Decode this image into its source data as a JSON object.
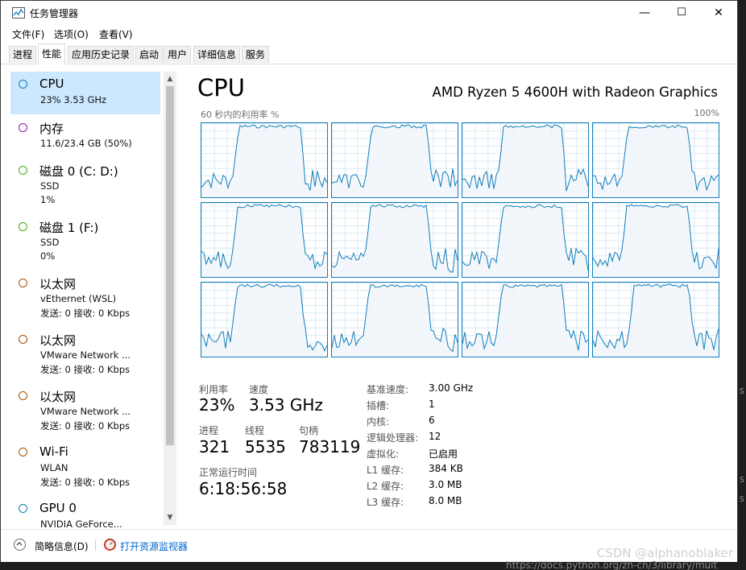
{
  "window": {
    "title": "任务管理器",
    "minimize": "—",
    "maximize": "☐",
    "close": "✕"
  },
  "menu": [
    "文件(F)",
    "选项(O)",
    "查看(V)"
  ],
  "tabs": [
    "进程",
    "性能",
    "应用历史记录",
    "启动",
    "用户",
    "详细信息",
    "服务"
  ],
  "active_tab": 1,
  "sidebar": {
    "items": [
      {
        "title": "CPU",
        "sub1": "23%  3.53 GHz",
        "sub2": "",
        "color": "#117dbb"
      },
      {
        "title": "内存",
        "sub1": "11.6/23.4 GB (50%)",
        "sub2": "",
        "color": "#8b12ae"
      },
      {
        "title": "磁盘 0 (C: D:)",
        "sub1": "SSD",
        "sub2": "1%",
        "color": "#4da60c"
      },
      {
        "title": "磁盘 1 (F:)",
        "sub1": "SSD",
        "sub2": "0%",
        "color": "#4da60c"
      },
      {
        "title": "以太网",
        "sub1": "vEthernet (WSL)",
        "sub2": "发送: 0 接收: 0 Kbps",
        "color": "#a74f01"
      },
      {
        "title": "以太网",
        "sub1": "VMware Network ...",
        "sub2": "发送: 0 接收: 0 Kbps",
        "color": "#a74f01"
      },
      {
        "title": "以太网",
        "sub1": "VMware Network ...",
        "sub2": "发送: 0 接收: 0 Kbps",
        "color": "#a74f01"
      },
      {
        "title": "Wi-Fi",
        "sub1": "WLAN",
        "sub2": "发送: 0 接收: 0 Kbps",
        "color": "#a74f01"
      },
      {
        "title": "GPU 0",
        "sub1": "NVIDIA GeForce...",
        "sub2": "",
        "color": "#117dbb"
      }
    ]
  },
  "cpu": {
    "title": "CPU",
    "model": "AMD Ryzen 5 4600H with Radeon Graphics",
    "graph_caption": "60 秒内的利用率 %",
    "graph_max": "100%",
    "stats": {
      "utilization_label": "利用率",
      "utilization": "23%",
      "speed_label": "速度",
      "speed": "3.53 GHz",
      "processes_label": "进程",
      "processes": "321",
      "threads_label": "线程",
      "threads": "5535",
      "handles_label": "句柄",
      "handles": "783119",
      "uptime_label": "正常运行时间",
      "uptime": "6:18:56:58"
    },
    "specs": [
      {
        "label": "基准速度:",
        "value": "3.00 GHz"
      },
      {
        "label": "插槽:",
        "value": "1"
      },
      {
        "label": "内核:",
        "value": "6"
      },
      {
        "label": "逻辑处理器:",
        "value": "12"
      },
      {
        "label": "虚拟化:",
        "value": "已启用"
      },
      {
        "label": "L1 缓存:",
        "value": "384 KB"
      },
      {
        "label": "L2 缓存:",
        "value": "3.0 MB"
      },
      {
        "label": "L3 缓存:",
        "value": "8.0 MB"
      }
    ],
    "line_color": "#117dbb",
    "fill_color": "#f1f6fa"
  },
  "footer": {
    "summary": "简略信息(D)",
    "monitor": "打开资源监视器"
  },
  "watermark": "CSDN @alphanoblaker",
  "background_fragments": [
    "s",
    "s",
    "s",
    "https://docs.python.org/zh-cn/3/library/mult"
  ]
}
